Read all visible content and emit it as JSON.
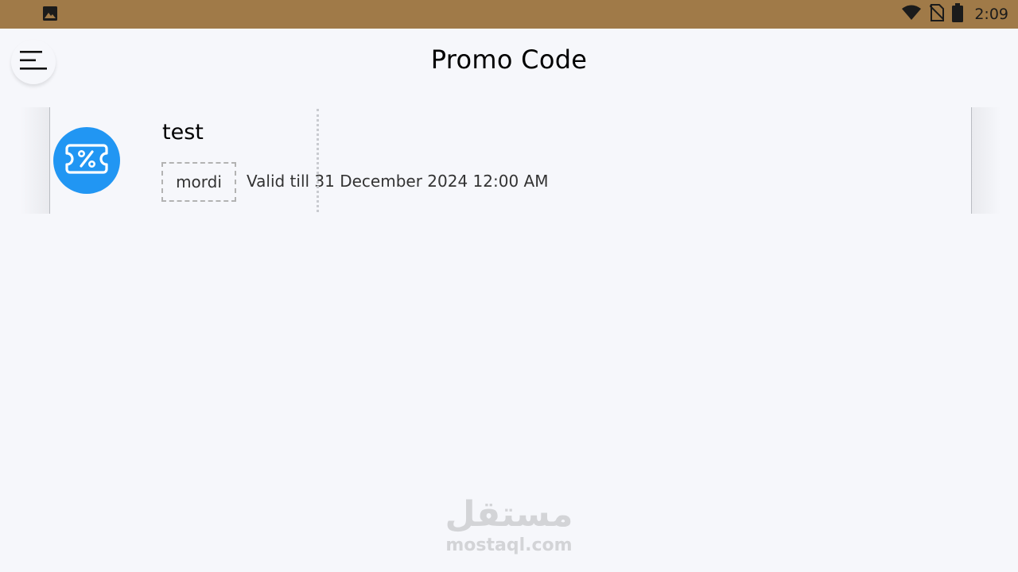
{
  "status_bar": {
    "time": "2:09",
    "left_icon": "image-icon",
    "right_icons": [
      "wifi-icon",
      "no-sim-icon",
      "battery-icon"
    ],
    "background": "#a07a48"
  },
  "app_bar": {
    "title": "Promo Code",
    "menu_icon": "menu-icon"
  },
  "promo_codes": [
    {
      "name": "test",
      "code": "mordi",
      "valid_till": "Valid till 31 December 2024 12:00 AM",
      "icon": "ticket-percent-icon",
      "icon_color": "#2196f3"
    }
  ],
  "watermark": {
    "arabic": "مستقل",
    "latin": "mostaql.com"
  }
}
